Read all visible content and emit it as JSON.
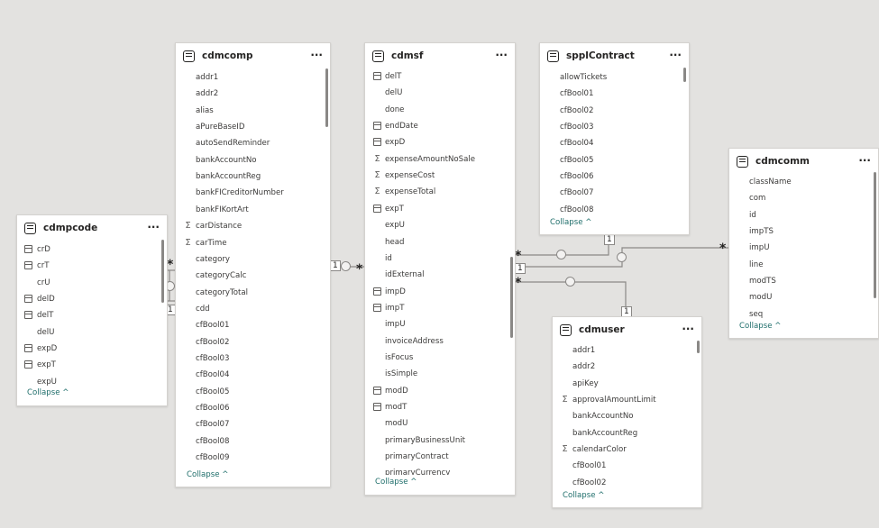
{
  "tables": {
    "cdmpcode": {
      "title": "cdmpcode",
      "collapse_label": "Collapse ^",
      "fields": [
        {
          "name": "crD",
          "icon": "date"
        },
        {
          "name": "crT",
          "icon": "date"
        },
        {
          "name": "crU",
          "icon": ""
        },
        {
          "name": "delD",
          "icon": "date"
        },
        {
          "name": "delT",
          "icon": "date"
        },
        {
          "name": "delU",
          "icon": ""
        },
        {
          "name": "expD",
          "icon": "date"
        },
        {
          "name": "expT",
          "icon": "date"
        },
        {
          "name": "expU",
          "icon": ""
        }
      ]
    },
    "cdmcomp": {
      "title": "cdmcomp",
      "collapse_label": "Collapse ^",
      "fields": [
        {
          "name": "addr1",
          "icon": ""
        },
        {
          "name": "addr2",
          "icon": ""
        },
        {
          "name": "alias",
          "icon": ""
        },
        {
          "name": "aPureBaseID",
          "icon": ""
        },
        {
          "name": "autoSendReminder",
          "icon": ""
        },
        {
          "name": "bankAccountNo",
          "icon": ""
        },
        {
          "name": "bankAccountReg",
          "icon": ""
        },
        {
          "name": "bankFICreditorNumber",
          "icon": ""
        },
        {
          "name": "bankFIKortArt",
          "icon": ""
        },
        {
          "name": "carDistance",
          "icon": "sum"
        },
        {
          "name": "carTime",
          "icon": "sum"
        },
        {
          "name": "category",
          "icon": ""
        },
        {
          "name": "categoryCalc",
          "icon": ""
        },
        {
          "name": "categoryTotal",
          "icon": ""
        },
        {
          "name": "cdd",
          "icon": ""
        },
        {
          "name": "cfBool01",
          "icon": ""
        },
        {
          "name": "cfBool02",
          "icon": ""
        },
        {
          "name": "cfBool03",
          "icon": ""
        },
        {
          "name": "cfBool04",
          "icon": ""
        },
        {
          "name": "cfBool05",
          "icon": ""
        },
        {
          "name": "cfBool06",
          "icon": ""
        },
        {
          "name": "cfBool07",
          "icon": ""
        },
        {
          "name": "cfBool08",
          "icon": ""
        },
        {
          "name": "cfBool09",
          "icon": ""
        }
      ]
    },
    "cdmsf": {
      "title": "cdmsf",
      "collapse_label": "Collapse ^",
      "fields": [
        {
          "name": "delT",
          "icon": "date"
        },
        {
          "name": "delU",
          "icon": ""
        },
        {
          "name": "done",
          "icon": ""
        },
        {
          "name": "endDate",
          "icon": "date"
        },
        {
          "name": "expD",
          "icon": "date"
        },
        {
          "name": "expenseAmountNoSale",
          "icon": "sum"
        },
        {
          "name": "expenseCost",
          "icon": "sum"
        },
        {
          "name": "expenseTotal",
          "icon": "sum"
        },
        {
          "name": "expT",
          "icon": "date"
        },
        {
          "name": "expU",
          "icon": ""
        },
        {
          "name": "head",
          "icon": ""
        },
        {
          "name": "id",
          "icon": ""
        },
        {
          "name": "idExternal",
          "icon": ""
        },
        {
          "name": "impD",
          "icon": "date"
        },
        {
          "name": "impT",
          "icon": "date"
        },
        {
          "name": "impU",
          "icon": ""
        },
        {
          "name": "invoiceAddress",
          "icon": ""
        },
        {
          "name": "isFocus",
          "icon": ""
        },
        {
          "name": "isSimple",
          "icon": ""
        },
        {
          "name": "modD",
          "icon": "date"
        },
        {
          "name": "modT",
          "icon": "date"
        },
        {
          "name": "modU",
          "icon": ""
        },
        {
          "name": "primaryBusinessUnit",
          "icon": ""
        },
        {
          "name": "primaryContract",
          "icon": ""
        },
        {
          "name": "primaryCurrency",
          "icon": ""
        }
      ]
    },
    "spplContract": {
      "title": "spplContract",
      "collapse_label": "Collapse ^",
      "fields": [
        {
          "name": "allowTickets",
          "icon": ""
        },
        {
          "name": "cfBool01",
          "icon": ""
        },
        {
          "name": "cfBool02",
          "icon": ""
        },
        {
          "name": "cfBool03",
          "icon": ""
        },
        {
          "name": "cfBool04",
          "icon": ""
        },
        {
          "name": "cfBool05",
          "icon": ""
        },
        {
          "name": "cfBool06",
          "icon": ""
        },
        {
          "name": "cfBool07",
          "icon": ""
        },
        {
          "name": "cfBool08",
          "icon": ""
        }
      ]
    },
    "cdmcomm": {
      "title": "cdmcomm",
      "collapse_label": "Collapse ^",
      "fields": [
        {
          "name": "className",
          "icon": ""
        },
        {
          "name": "com",
          "icon": ""
        },
        {
          "name": "id",
          "icon": ""
        },
        {
          "name": "impTS",
          "icon": ""
        },
        {
          "name": "impU",
          "icon": ""
        },
        {
          "name": "line",
          "icon": ""
        },
        {
          "name": "modTS",
          "icon": ""
        },
        {
          "name": "modU",
          "icon": ""
        },
        {
          "name": "seq",
          "icon": ""
        }
      ]
    },
    "cdmuser": {
      "title": "cdmuser",
      "collapse_label": "Collapse ^",
      "fields": [
        {
          "name": "addr1",
          "icon": ""
        },
        {
          "name": "addr2",
          "icon": ""
        },
        {
          "name": "apiKey",
          "icon": ""
        },
        {
          "name": "approvalAmountLimit",
          "icon": "sum"
        },
        {
          "name": "bankAccountNo",
          "icon": ""
        },
        {
          "name": "bankAccountReg",
          "icon": ""
        },
        {
          "name": "calendarColor",
          "icon": "sum"
        },
        {
          "name": "cfBool01",
          "icon": ""
        },
        {
          "name": "cfBool02",
          "icon": ""
        }
      ]
    }
  },
  "relationships": {
    "one": "1",
    "many": "*"
  },
  "menu_glyph": "···",
  "colors": {
    "canvas": "#e3e2e0",
    "card": "#ffffff",
    "link": "#1f6e6b",
    "line": "#8a8886"
  }
}
